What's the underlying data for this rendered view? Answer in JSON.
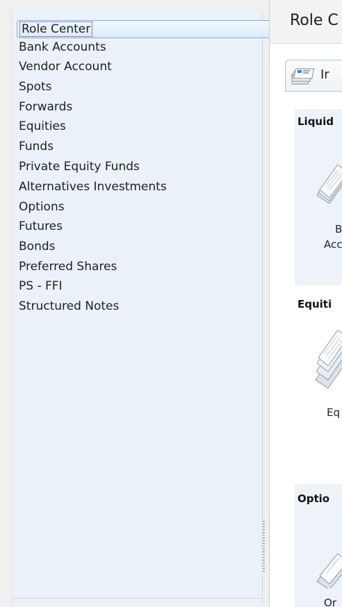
{
  "nav": {
    "items": [
      {
        "label": "Role Center",
        "selected": true
      },
      {
        "label": "Bank Accounts"
      },
      {
        "label": "Vendor Account"
      },
      {
        "label": "Spots"
      },
      {
        "label": "Forwards"
      },
      {
        "label": "Equities"
      },
      {
        "label": "Funds"
      },
      {
        "label": "Private Equity Funds"
      },
      {
        "label": "Alternatives Investments"
      },
      {
        "label": "Options"
      },
      {
        "label": "Futures"
      },
      {
        "label": "Bonds"
      },
      {
        "label": "Preferred Shares"
      },
      {
        "label": "PS - FFI"
      },
      {
        "label": "Structured Notes"
      }
    ]
  },
  "content": {
    "title": "Role C",
    "tab": {
      "label": "Ir",
      "icon": "stacked-papers-icon"
    },
    "groups": [
      {
        "title": "Liquid",
        "tile_label_1": "B",
        "tile_label_2": "Acc",
        "icon": "document-stack-icon"
      },
      {
        "title": "Equiti",
        "tile_label_1": "Eq",
        "icon": "document-stack-icon"
      },
      {
        "title": "Optio",
        "tile_label_1": "Or",
        "icon": "document-stack-icon"
      }
    ]
  },
  "colors": {
    "nav_background": "#eaf1f8",
    "selection_border": "#84acdd",
    "group_background": "#eef3fa"
  }
}
